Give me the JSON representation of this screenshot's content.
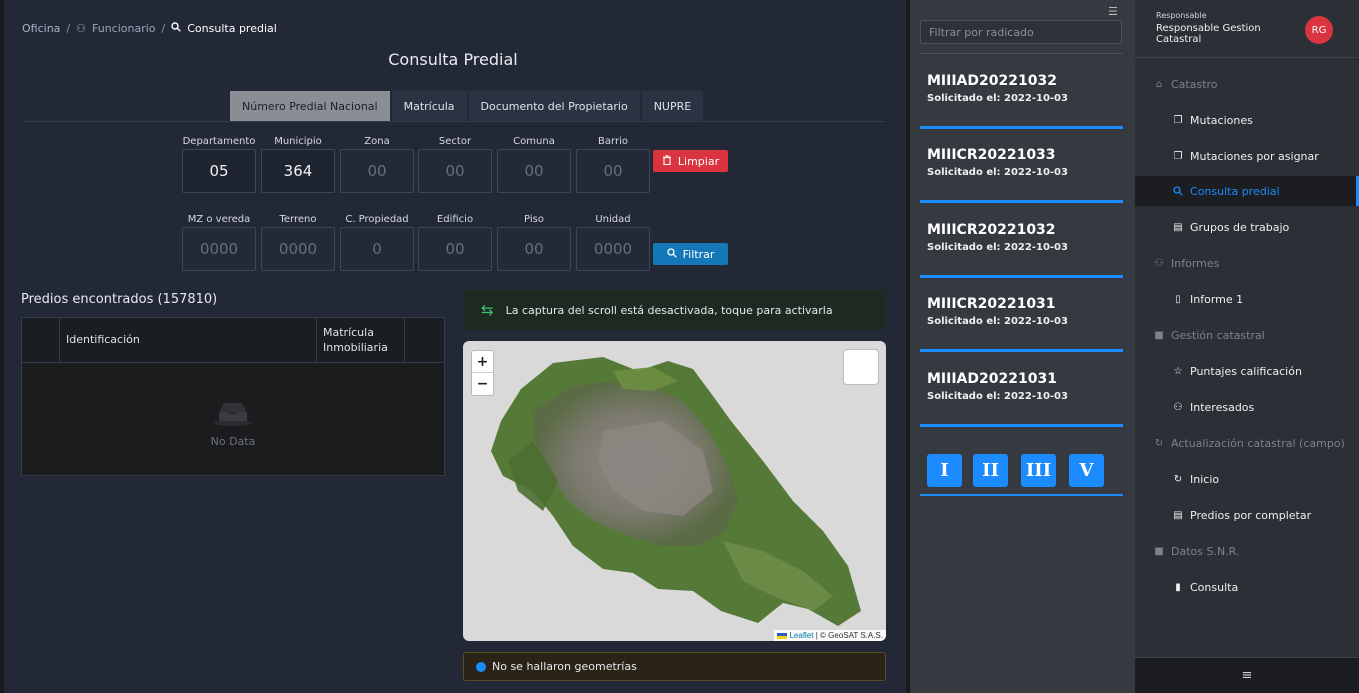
{
  "breadcrumb": {
    "items": [
      "Oficina",
      "Funcionario",
      "Consulta predial"
    ]
  },
  "page_title": "Consulta Predial",
  "tabs": [
    {
      "label": "Número Predial Nacional"
    },
    {
      "label": "Matrícula"
    },
    {
      "label": "Documento del Propietario"
    },
    {
      "label": "NUPRE"
    }
  ],
  "fields_row1": [
    {
      "label": "Departamento",
      "value": "05"
    },
    {
      "label": "Municipio",
      "value": "364"
    },
    {
      "label": "Zona",
      "value": "00"
    },
    {
      "label": "Sector",
      "value": "00"
    },
    {
      "label": "Comuna",
      "value": "00"
    },
    {
      "label": "Barrio",
      "value": "00"
    }
  ],
  "fields_row2": [
    {
      "label": "MZ o vereda",
      "value": "0000"
    },
    {
      "label": "Terreno",
      "value": "0000"
    },
    {
      "label": "C. Propiedad",
      "value": "0"
    },
    {
      "label": "Edificio",
      "value": "00"
    },
    {
      "label": "Piso",
      "value": "00"
    },
    {
      "label": "Unidad",
      "value": "0000"
    }
  ],
  "buttons": {
    "clear": "Limpiar",
    "filter": "Filtrar"
  },
  "results": {
    "title": "Predios encontrados (157810)",
    "columns": [
      "Identificación",
      "Matrícula Inmobiliaria"
    ],
    "empty_text": "No Data"
  },
  "scroll_notice": "La captura del scroll está desactivada, toque para activarla",
  "map": {
    "zoom_in": "+",
    "zoom_out": "−",
    "attribution_link": "Leaflet",
    "attribution_text": "| © GeoSAT S.A.S."
  },
  "geometry_status": "No se hallaron geometrías",
  "radicados": {
    "filter_placeholder": "Filtrar por radicado",
    "items": [
      {
        "code": "MIIIAD20221032",
        "date": "Solicitado el: 2022-10-03"
      },
      {
        "code": "MIIICR20221033",
        "date": "Solicitado el: 2022-10-03"
      },
      {
        "code": "MIIICR20221032",
        "date": "Solicitado el: 2022-10-03"
      },
      {
        "code": "MIIICR20221031",
        "date": "Solicitado el: 2022-10-03"
      },
      {
        "code": "MIIIAD20221031",
        "date": "Solicitado el: 2022-10-03"
      }
    ],
    "categories": [
      "I",
      "II",
      "III",
      "V"
    ]
  },
  "sidebar": {
    "role_label": "Responsable",
    "user_name": "Responsable Gestion Catastral",
    "avatar_initials": "RG",
    "menu": [
      {
        "label": "Catastro",
        "type": "group",
        "icon": "bank-icon"
      },
      {
        "label": "Mutaciones",
        "type": "item",
        "icon": "copy-icon"
      },
      {
        "label": "Mutaciones por asignar",
        "type": "item",
        "icon": "copy-icon"
      },
      {
        "label": "Consulta predial",
        "type": "item",
        "icon": "search-icon",
        "active": true
      },
      {
        "label": "Grupos de trabajo",
        "type": "item",
        "icon": "list-icon"
      },
      {
        "label": "Informes",
        "type": "group",
        "icon": "users-icon"
      },
      {
        "label": "Informe 1",
        "type": "item",
        "icon": "file-icon"
      },
      {
        "label": "Gestión catastral",
        "type": "group",
        "icon": "book-icon"
      },
      {
        "label": "Puntajes calificación",
        "type": "item",
        "icon": "star-icon"
      },
      {
        "label": "Interesados",
        "type": "item",
        "icon": "users-icon"
      },
      {
        "label": "Actualización catastral (campo)",
        "type": "group",
        "icon": "sync-icon"
      },
      {
        "label": "Inicio",
        "type": "item",
        "icon": "sync-icon"
      },
      {
        "label": "Predios por completar",
        "type": "item",
        "icon": "list-icon"
      },
      {
        "label": "Datos S.N.R.",
        "type": "group",
        "icon": "book-icon"
      },
      {
        "label": "Consulta",
        "type": "item",
        "icon": "clipboard-icon"
      }
    ]
  },
  "colors": {
    "accent": "#1b8bff",
    "danger": "#d9343f",
    "filter_button": "#1478b8"
  }
}
